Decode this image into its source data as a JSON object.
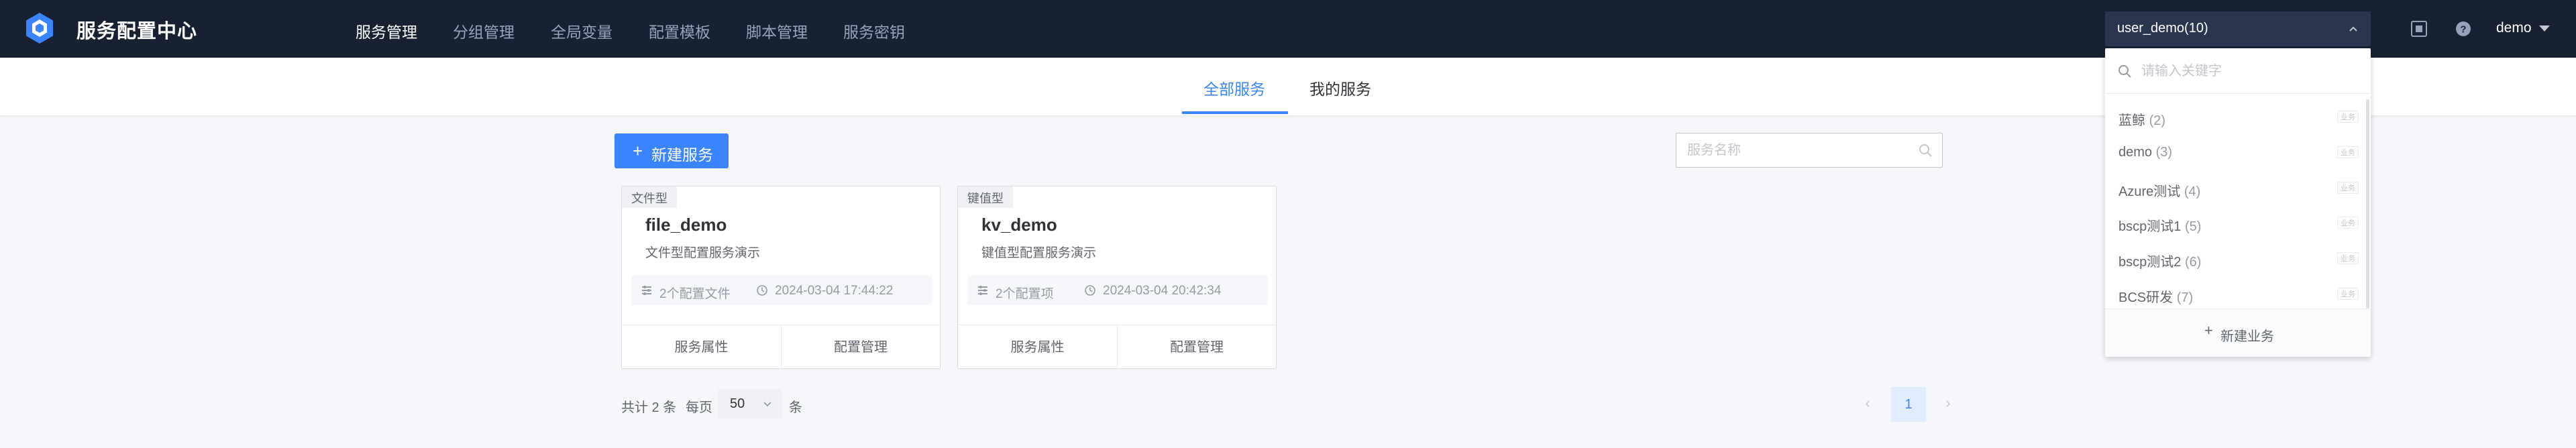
{
  "app": {
    "title": "服务配置中心"
  },
  "nav": {
    "items": [
      {
        "label": "服务管理",
        "active": true
      },
      {
        "label": "分组管理",
        "active": false
      },
      {
        "label": "全局变量",
        "active": false
      },
      {
        "label": "配置模板",
        "active": false
      },
      {
        "label": "脚本管理",
        "active": false
      },
      {
        "label": "服务密钥",
        "active": false
      }
    ]
  },
  "business_select": {
    "value": "user_demo(10)"
  },
  "user": {
    "name": "demo"
  },
  "tabs": [
    {
      "label": "全部服务",
      "active": true
    },
    {
      "label": "我的服务",
      "active": false
    }
  ],
  "toolbar": {
    "new_service_label": "新建服务",
    "search_placeholder": "服务名称"
  },
  "services": [
    {
      "type_tag": "文件型",
      "name": "file_demo",
      "description": "文件型配置服务演示",
      "config_count": "2个配置文件",
      "updated_at": "2024-03-04 17:44:22",
      "action_attrs": "服务属性",
      "action_manage": "配置管理"
    },
    {
      "type_tag": "键值型",
      "name": "kv_demo",
      "description": "键值型配置服务演示",
      "config_count": "2个配置项",
      "updated_at": "2024-03-04 20:42:34",
      "action_attrs": "服务属性",
      "action_manage": "配置管理"
    }
  ],
  "pagination": {
    "total_text": "共计 2 条",
    "per_page_label": "每页",
    "per_page_value": "50",
    "per_page_unit": "条",
    "current_page": "1",
    "prev": "‹",
    "next": "›"
  },
  "business_dropdown": {
    "search_placeholder": "请输入关键字",
    "items": [
      {
        "name": "蓝鲸",
        "count": "(2)",
        "badge": "业务"
      },
      {
        "name": "demo",
        "count": "(3)",
        "badge": "业务"
      },
      {
        "name": "Azure测试",
        "count": "(4)",
        "badge": "业务"
      },
      {
        "name": "bscp测试1",
        "count": "(5)",
        "badge": "业务"
      },
      {
        "name": "bscp测试2",
        "count": "(6)",
        "badge": "业务"
      },
      {
        "name": "BCS研发",
        "count": "(7)",
        "badge": "业务"
      }
    ],
    "footer_label": "新建业务"
  },
  "colors": {
    "topbar_bg": "#182132",
    "accent": "#3a84ff",
    "page_bg": "#f5f7fa"
  }
}
